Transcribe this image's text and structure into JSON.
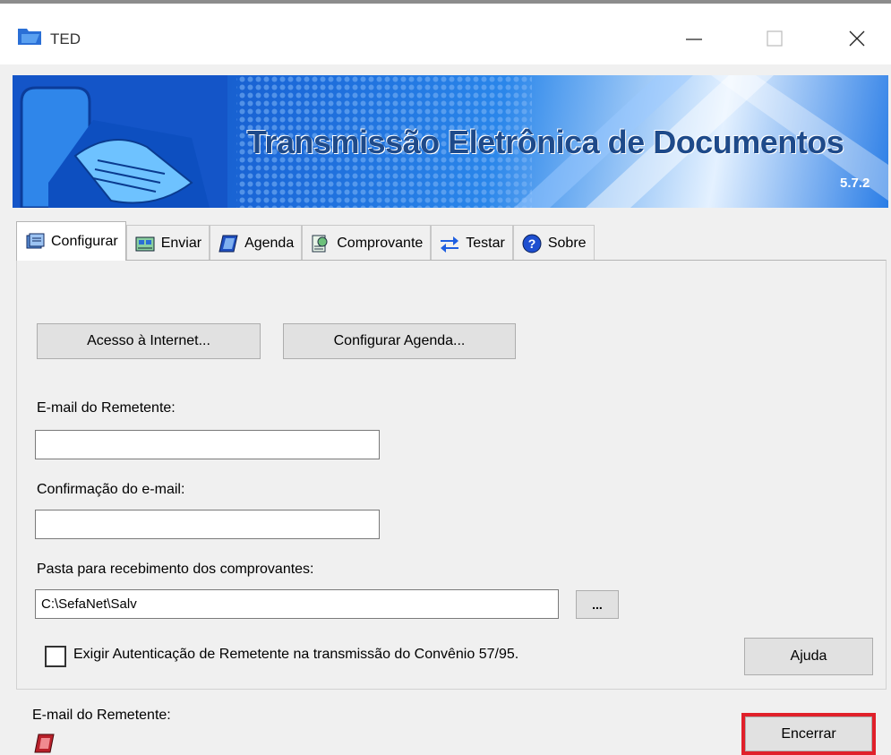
{
  "window": {
    "title": "TED",
    "minimize_icon": "minimize-icon",
    "maximize_icon": "maximize-icon",
    "close_icon": "close-icon"
  },
  "banner": {
    "title": "Transmissão Eletrônica de Documentos",
    "version": "5.7.2"
  },
  "tabs": [
    {
      "label": "Configurar",
      "icon": "configure-icon",
      "active": true
    },
    {
      "label": "Enviar",
      "icon": "send-icon",
      "active": false
    },
    {
      "label": "Agenda",
      "icon": "agenda-icon",
      "active": false
    },
    {
      "label": "Comprovante",
      "icon": "receipt-icon",
      "active": false
    },
    {
      "label": "Testar",
      "icon": "test-icon",
      "active": false
    },
    {
      "label": "Sobre",
      "icon": "help-icon",
      "active": false
    }
  ],
  "config": {
    "internet_button": "Acesso à Internet...",
    "agenda_button": "Configurar Agenda...",
    "email_label": "E-mail do Remetente:",
    "email_value": "",
    "confirm_label": "Confirmação do e-mail:",
    "confirm_value": "",
    "folder_label": "Pasta para recebimento dos comprovantes:",
    "folder_value": "C:\\SefaNet\\Salv",
    "browse_button": "...",
    "auth_checkbox_label": "Exigir Autenticação de Remetente na transmissão do Convênio 57/95.",
    "auth_checked": false,
    "help_button": "Ajuda"
  },
  "footer": {
    "status_label": "E-mail do Remetente:",
    "close_button": "Encerrar"
  },
  "colors": {
    "highlight": "#e0202a",
    "banner_blue": "#1b68d8",
    "window_bg": "#f0f0f0"
  }
}
